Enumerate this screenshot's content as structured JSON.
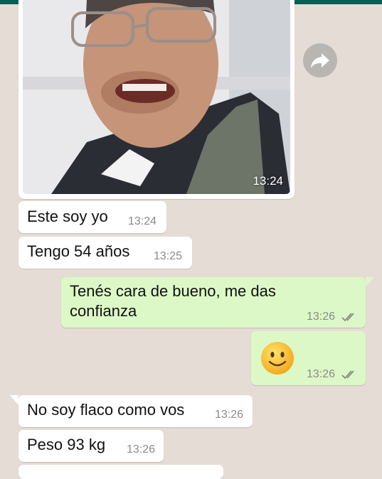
{
  "chat": {
    "image_message": {
      "time": "13:24"
    },
    "messages": [
      {
        "text": "Este soy yo",
        "time": "13:24"
      },
      {
        "text": "Tengo 54 años",
        "time": "13:25"
      },
      {
        "text": "Tenés cara de bueno, me das",
        "text2": "confianza",
        "time": "13:26"
      },
      {
        "emoji": "🙂",
        "time": "13:26"
      },
      {
        "text": "No soy flaco como vos",
        "time": "13:26"
      },
      {
        "text": "Peso 93 kg",
        "time": "13:26"
      }
    ]
  },
  "colors": {
    "incoming_bubble": "#ffffff",
    "outgoing_bubble": "#dcf8c6",
    "background": "#e5ddd5",
    "header": "#075e54",
    "read_ticks": "#8a8a8a"
  },
  "icons": {
    "forward": "forward-arrow-icon",
    "read_receipt": "double-check-icon",
    "emoji": "slightly-smiling-face"
  }
}
